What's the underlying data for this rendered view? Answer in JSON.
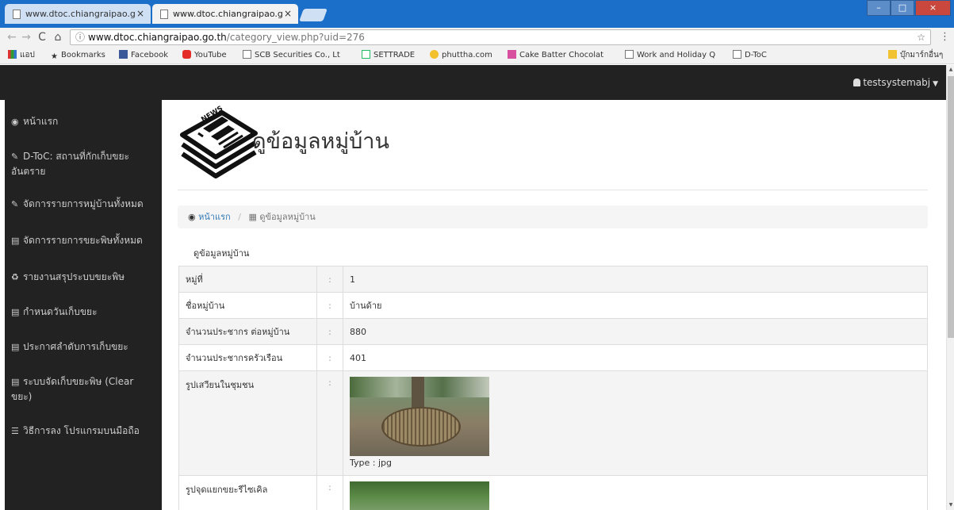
{
  "browser": {
    "tabs": [
      {
        "label": "www.dtoc.chiangraipao.g",
        "active": false
      },
      {
        "label": "www.dtoc.chiangraipao.g",
        "active": true
      }
    ],
    "tab_close": "×",
    "window_controls": {
      "minimize": "–",
      "maximize": "□",
      "close": "×"
    },
    "url_host": "www.dtoc.chiangraipao.go.th",
    "url_path": "/category_view.php?uid=276",
    "bookmarks": [
      {
        "label": "แอป",
        "icon": "apps-icon"
      },
      {
        "label": "Bookmarks",
        "icon": "star-icon"
      },
      {
        "label": "Facebook",
        "icon": "facebook-icon"
      },
      {
        "label": "YouTube",
        "icon": "youtube-icon"
      },
      {
        "label": "SCB Securities Co., Lt",
        "icon": "page-icon"
      },
      {
        "label": "SETTRADE",
        "icon": "settrade-icon"
      },
      {
        "label": "phuttha.com",
        "icon": "phuttha-icon"
      },
      {
        "label": "Cake Batter Chocolat",
        "icon": "cake-icon"
      },
      {
        "label": "Work and Holiday Q",
        "icon": "page-icon"
      },
      {
        "label": "D-ToC",
        "icon": "page-icon"
      }
    ],
    "other_bookmarks": "บุ๊กมาร์กอื่นๆ"
  },
  "topnav": {
    "username": "testsystemabj"
  },
  "sidebar": {
    "items": [
      {
        "label": "หน้าแรก",
        "icon": "dashboard-icon"
      },
      {
        "label": "D-ToC: สถานที่กักเก็บขยะอันตราย",
        "icon": "wrench-icon"
      },
      {
        "label": "จัดการรายการหมู่บ้านทั้งหมด",
        "icon": "wrench-icon"
      },
      {
        "label": "จัดการรายการขยะพิษทั้งหมด",
        "icon": "newspaper-icon"
      },
      {
        "label": "รายงานสรุประบบขยะพิษ",
        "icon": "recycle-icon"
      },
      {
        "label": "กำหนดวันเก็บขยะ",
        "icon": "newspaper-icon"
      },
      {
        "label": "ประกาศลำดับการเก็บขยะ",
        "icon": "newspaper-icon"
      },
      {
        "label": "ระบบจัดเก็บขยะพิษ (Clear ขยะ)",
        "icon": "newspaper-icon"
      },
      {
        "label": "วิธีการลง โปรแกรมบนมือถือ",
        "icon": "list-icon"
      }
    ]
  },
  "page": {
    "title": "ดูข้อมูลหมู่บ้าน",
    "breadcrumb": {
      "home": "หน้าแรก",
      "current": "ดูข้อมูลหมู่บ้าน"
    },
    "section_label": "ดูข้อมูลหมู่บ้าน",
    "colon": ":",
    "rows": [
      {
        "label": "หมู่ที่",
        "value": "1"
      },
      {
        "label": "ชื่อหมู่บ้าน",
        "value": "บ้านด้าย"
      },
      {
        "label": "จำนวนประชากร ต่อหมู่บ้าน",
        "value": "880"
      },
      {
        "label": "จำนวนประชากรครัวเรือน",
        "value": "401"
      }
    ],
    "image_rows": [
      {
        "label": "รูปเสวียนในชุมชน",
        "type_text": "Type : jpg"
      },
      {
        "label": "รูปจุดแยกขยะรีไซเคิล"
      }
    ]
  }
}
